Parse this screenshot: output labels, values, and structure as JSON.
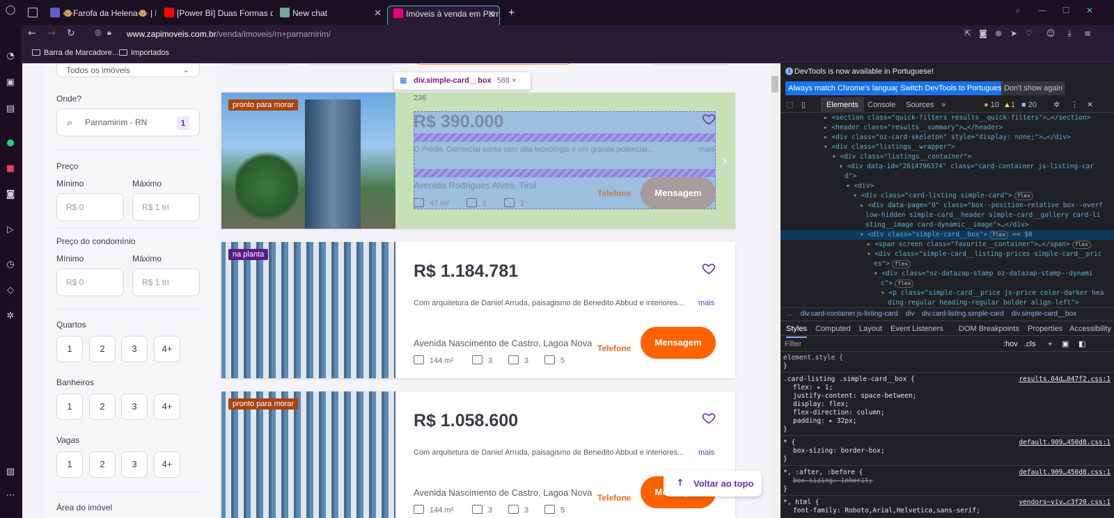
{
  "browser": {
    "tabs": [
      {
        "label": "",
        "icon": "gamepad-icon"
      },
      {
        "label": "🐵Farofa da Helena🐵 | M",
        "icon": "teams-icon"
      },
      {
        "label": "[Power BI] Duas Formas de",
        "icon": "youtube-icon"
      },
      {
        "label": "New chat",
        "icon": "chatgpt-icon"
      },
      {
        "label": "Imóveis à venda em Parnam",
        "icon": "zap-icon",
        "active": true
      }
    ],
    "url_host": "www.zapimoveis.com.br",
    "url_path": "/venda/imoveis/rn+parnamirim/",
    "bookmarks": [
      "Barra de Marcadore...",
      "Importados"
    ]
  },
  "filters": {
    "property_type": "Todos os imóveis",
    "where_label": "Onde?",
    "where_value": "Parnamirim - RN",
    "where_count": "1",
    "price_label": "Preço",
    "min_label": "Mínimo",
    "max_label": "Máximo",
    "min_placeholder": "R$ 0",
    "max_placeholder": "R$ 1 tri",
    "condo_label": "Preço do condomínio",
    "bedrooms_label": "Quartos",
    "bathrooms_label": "Banheiros",
    "parking_label": "Vagas",
    "chips": [
      "1",
      "2",
      "3",
      "4+"
    ],
    "area_label": "Área do imóvel"
  },
  "inspect_tooltip": {
    "tag": "div.simple-card__box",
    "size": "588 × 236"
  },
  "listings": [
    {
      "badge": "pronto para morar",
      "price": "R$ 390.000",
      "description": "O Prédio Comercial conta com alta tecnologia e um grande potencial...",
      "more": "mais",
      "address": "Avenida Rodrigues Alves, Tirol",
      "area": "47 m²",
      "parking": "1",
      "bathrooms": "1",
      "phone": "Telefone",
      "message": "Mensagem"
    },
    {
      "badge": "na planta",
      "price": "R$ 1.184.781",
      "description": "Com arquitetura de Daniel Arruda, paisagismo de Benedito Abbud e interiores...",
      "more": "mais",
      "address": "Avenida Nascimento de Castro, Lagoa Nova",
      "area": "144 m²",
      "bedrooms": "3",
      "parking": "3",
      "bathrooms": "5",
      "phone": "Telefone",
      "message": "Mensagem"
    },
    {
      "badge": "pronto para morar",
      "price": "R$ 1.058.600",
      "description": "Com arquitetura de Daniel Arruda, paisagismo de Benedito Abbud e interiores...",
      "more": "mais",
      "address": "Avenida Nascimento de Castro, Lagoa Nova",
      "area": "144 m²",
      "bedrooms": "3",
      "parking": "3",
      "bathrooms": "5",
      "phone": "Telefone",
      "message": "Mensagem"
    }
  ],
  "back_to_top": "Voltar ao topo",
  "devtools": {
    "info": "DevTools is now available in Portuguese!",
    "btn_match": "Always match Chrome's language",
    "btn_switch": "Switch DevTools to Portuguese",
    "btn_dont": "Don't show again",
    "tabs": [
      "Elements",
      "Console",
      "Sources"
    ],
    "errors": "10",
    "warnings": "1",
    "messages": "20",
    "dom_lines": [
      "<section class=\"quick-filters results__quick-filters\">…</section>",
      "<header class=\"results__summary\">…</header>",
      "<div class=\"oz-card-skeleton\" style=\"display: none;\">…</div>",
      "<div class=\"listings__wrapper\">",
      "<div class=\"listings__container\">",
      "<div data-id=\"2614796374\" class=\"card-container js-listing-car",
      "d\">",
      "<div>",
      "<div class=\"card-listing simple-card\">",
      "<div data-page=\"0\" class=\"box--position-relative box--overf",
      "low-hidden simple-card__header simple-card__gallery card-li",
      "sting__image card-dynamic__image\">…</div>",
      "<div class=\"simple-card__box\">",
      "<span screen class=\"favorite__container\">…</span>",
      "<div class=\"simple-card__listing-prices simple-card__pric",
      "es\">",
      "<div class=\"oz-datazap-stamp oz-datazap-stamp--dynami",
      "c\">",
      "<p class=\"simple-card__price js-price color-darker hea",
      "ding-regular heading-regular  bolder align-left\">"
    ],
    "breadcrumbs": [
      "div.card-container.js-listing-card",
      "div",
      "div.card-listing.simple-card",
      "div.simple-card__box"
    ],
    "style_tabs": [
      "Styles",
      "Computed",
      "Layout",
      "Event Listeners",
      "DOM Breakpoints",
      "Properties",
      "Accessibility"
    ],
    "filter": "Filter",
    "hov": ":hov",
    "cls": ".cls",
    "css_lines": [
      "element.style {",
      "}",
      ".card-listing .simple-card__box {",
      "flex: ▸ 1;",
      "justify-content: space-between;",
      "display: flex;",
      "flex-direction: column;",
      "padding: ▸ 32px;",
      "}",
      "* {",
      "box-sizing: border-box;",
      "}",
      "*, :after, :before {",
      "box-sizing: inherit;",
      "}",
      "*, html {",
      "font-family: Roboto,Arial,Helvetica,sans-serif;"
    ],
    "css_sources": [
      "results.64d…047f2.css:1",
      "default.909…450d8.css:1",
      "default.909…450d8.css:1",
      "vendors~viv…c3f20.css:1"
    ]
  }
}
